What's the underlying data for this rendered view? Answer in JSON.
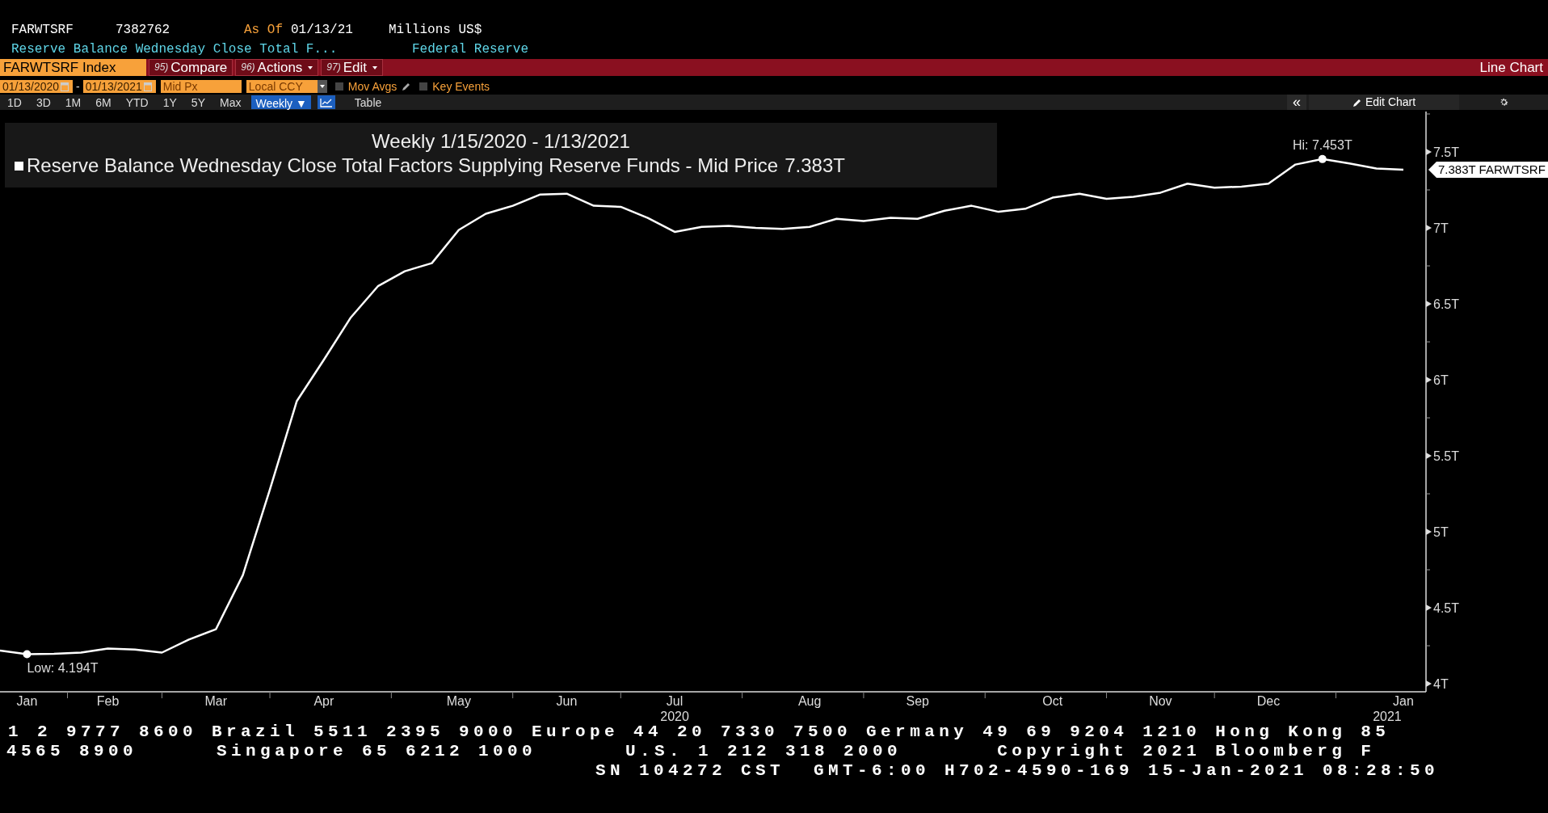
{
  "header": {
    "ticker": "FARWTSRF",
    "value": "7382762",
    "as_of_label": "As Of",
    "as_of_date": "01/13/21",
    "units": "Millions US$",
    "description": "Reserve Balance Wednesday Close Total F...",
    "source": "Federal Reserve"
  },
  "command_bar": {
    "security": "FARWTSRF Index",
    "menus": [
      {
        "number": "95)",
        "label": "Compare",
        "dropdown": false
      },
      {
        "number": "96)",
        "label": "Actions",
        "dropdown": true
      },
      {
        "number": "97)",
        "label": "Edit",
        "dropdown": true
      }
    ],
    "view": "Line Chart"
  },
  "settings": {
    "start_date": "01/13/2020",
    "separator": "-",
    "end_date": "01/13/2021",
    "price_field": "Mid Px",
    "currency": "Local CCY",
    "toggles": [
      {
        "label": "Mov Avgs",
        "checked": false,
        "editable": true
      },
      {
        "label": "Key Events",
        "checked": false,
        "editable": false
      }
    ]
  },
  "toolbar": {
    "ranges": [
      "1D",
      "3D",
      "1M",
      "6M",
      "YTD",
      "1Y",
      "5Y",
      "Max"
    ],
    "frequency": "Weekly ▼",
    "table": "Table",
    "collapse": "«",
    "edit_chart": "Edit Chart"
  },
  "chart": {
    "legend_title": "Weekly 1/15/2020 - 1/13/2021",
    "legend_series": "Reserve Balance Wednesday Close Total Factors Supplying Reserve Funds - Mid Price",
    "legend_value": "7.383T",
    "tag_value": "7.383T",
    "high_label": "Hi: 7.453T",
    "low_label": "Low: 4.194T",
    "year_labels": [
      "2020",
      "2021"
    ],
    "chart_data": {
      "type": "line",
      "categories": [
        null,
        "Jan",
        null,
        null,
        "Feb",
        null,
        null,
        null,
        "Mar",
        null,
        null,
        null,
        "Apr",
        null,
        null,
        null,
        null,
        "May",
        null,
        null,
        null,
        "Jun",
        null,
        null,
        null,
        "Jul",
        null,
        null,
        null,
        null,
        "Aug",
        null,
        null,
        null,
        "Sep",
        null,
        null,
        null,
        null,
        "Oct",
        null,
        null,
        null,
        "Nov",
        null,
        null,
        null,
        "Dec",
        null,
        null,
        null,
        null,
        "Jan"
      ],
      "series": [
        {
          "name": "FARWTSRF",
          "color": "#ffffff",
          "values": [
            4.219,
            4.194,
            4.197,
            4.205,
            4.232,
            4.225,
            4.205,
            4.291,
            4.358,
            4.715,
            5.278,
            5.861,
            6.132,
            6.411,
            6.616,
            6.715,
            6.768,
            6.987,
            7.093,
            7.146,
            7.219,
            7.225,
            7.146,
            7.139,
            7.066,
            6.974,
            7.007,
            7.013,
            7.0,
            6.993,
            7.007,
            7.06,
            7.046,
            7.066,
            7.06,
            7.113,
            7.146,
            7.106,
            7.126,
            7.199,
            7.225,
            7.192,
            7.205,
            7.232,
            7.291,
            7.265,
            7.272,
            7.291,
            7.417,
            7.453,
            7.424,
            7.391,
            7.383
          ]
        }
      ],
      "ylim": [
        3.947,
        7.766
      ],
      "yticks": [
        {
          "value": 4,
          "label": "4T"
        },
        {
          "value": 4.5,
          "label": "4.5T"
        },
        {
          "value": 5,
          "label": "5T"
        },
        {
          "value": 5.5,
          "label": "5.5T"
        },
        {
          "value": 6,
          "label": "6T"
        },
        {
          "value": 6.5,
          "label": "6.5T"
        },
        {
          "value": 7,
          "label": "7T"
        },
        {
          "value": 7.5,
          "label": "7.5T"
        }
      ]
    }
  },
  "footer": {
    "lines": [
      [
        "1 2 9777 8600 Brazil 5511 2395 9000 Europe 44 20 7330 7500 Germany 49 69 9204 1210 Hong Kong 85"
      ],
      [
        "4565 8900",
        "Singapore 65 6212 1000",
        "U.S. 1 212 318 2000",
        "Copyright 2021 Bloomberg F"
      ],
      [
        "SN 104272 CST  GMT-6:00 H702-4590-169 15-Jan-2021 08:28:50"
      ]
    ]
  }
}
